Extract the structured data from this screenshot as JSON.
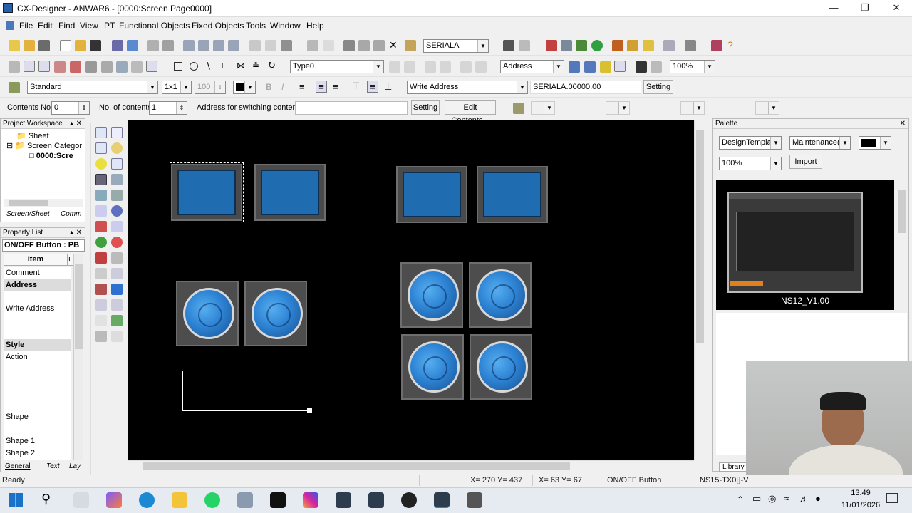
{
  "window": {
    "title": "CX-Designer - ANWAR6 - [0000:Screen Page0000]"
  },
  "menu": [
    "File",
    "Edit",
    "Find",
    "View",
    "PT",
    "Functional Objects",
    "Fixed Objects",
    "Tools",
    "Window",
    "Help"
  ],
  "toolbar1": {
    "port_select": "SERIALA"
  },
  "toolbar2": {
    "type_select": "Type0",
    "address_select": "Address",
    "zoom_select": "100%"
  },
  "toolbar3": {
    "style_select": "Standard",
    "grid_select": "1x1",
    "size_value": "100",
    "write_address_select": "Write Address",
    "address_value": "SERIALA.00000.00",
    "setting_button": "Setting"
  },
  "toolbar4": {
    "contents_no_label": "Contents No.",
    "contents_no_value": "0",
    "no_contents_label": "No. of contents",
    "no_contents_value": "1",
    "switch_address_label": "Address for switching contents",
    "switch_address_value": "",
    "setting_button": "Setting",
    "edit_contents_button": "Edit Contents..."
  },
  "workspace": {
    "title": "Project Workspace",
    "tree": [
      "Sheet",
      "Screen Categor",
      "0000:Scre"
    ],
    "tabs": [
      "Screen/Sheet",
      "Comm"
    ]
  },
  "properties": {
    "title": "Property List",
    "object": "ON/OFF Button : PB",
    "header_item": "Item",
    "header_value": "I",
    "rows": [
      "Comment",
      "Address",
      "Write Address",
      "Style",
      "Action",
      "Shape",
      "Shape 1",
      "Shape 2"
    ],
    "tabs": [
      "General",
      "Text",
      "Lay"
    ]
  },
  "palette": {
    "title": "Palette",
    "design_select": "DesignTemplat",
    "category_select": "Maintenance(C",
    "zoom_select": "100%",
    "import_button": "Import",
    "preview_caption": "NS12_V1.00",
    "library_tab": "Library"
  },
  "status": {
    "ready": "Ready",
    "cursor": "X= 270 Y= 437",
    "size": "X= 63 Y= 67",
    "object_type": "ON/OFF Button",
    "pt_model": "NS15-TX0[]-V"
  },
  "taskbar": {
    "time": "13.49",
    "date": "11/01/2026"
  },
  "colors": {
    "canvas": "#000000",
    "button_face": "#1f6cb0",
    "selection": "#ffffff"
  }
}
